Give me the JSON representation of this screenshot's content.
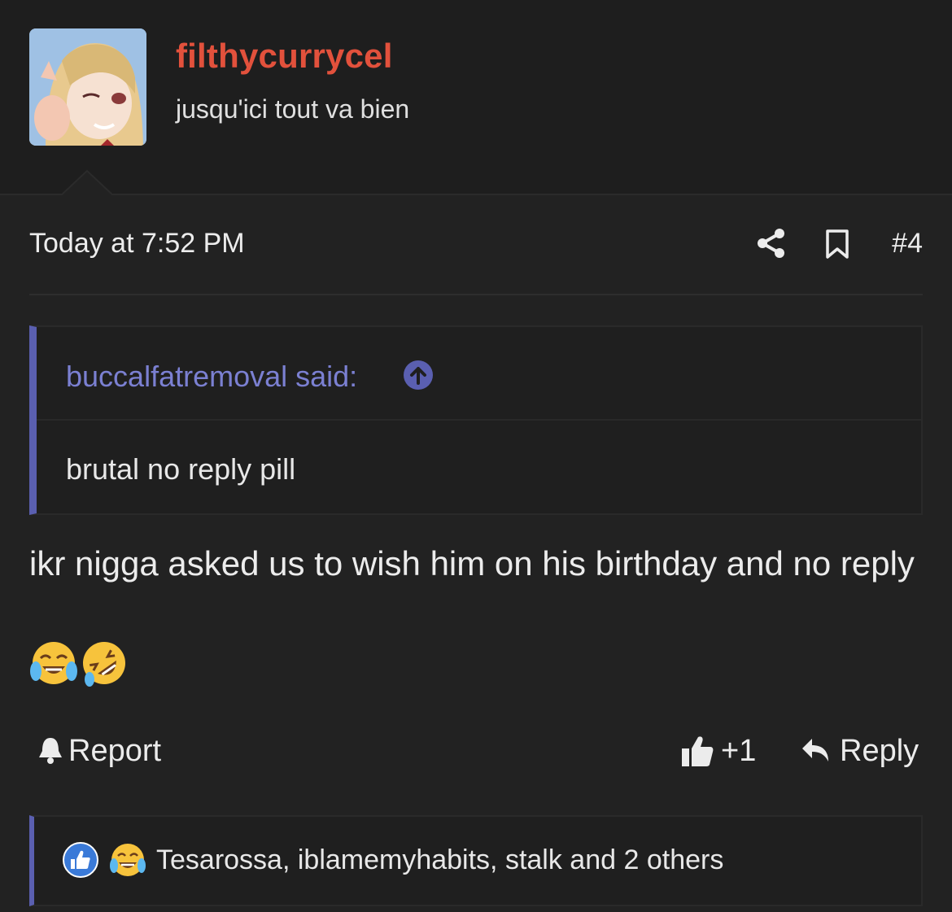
{
  "user": {
    "name": "filthycurrycel",
    "title": "jusqu'ici tout va bien"
  },
  "post": {
    "timestamp": "Today at 7:52 PM",
    "number": "#4",
    "quote": {
      "author_line": "buccalfatremoval said:",
      "text": "brutal no reply pill"
    },
    "message": "ikr nigga asked us to wish him on his birthday and no reply",
    "emojis": [
      "face-with-tears-of-joy",
      "rolling-on-floor-laughing"
    ]
  },
  "actions": {
    "report_label": "Report",
    "like_count": "+1",
    "reply_label": "Reply"
  },
  "reactions": {
    "icons": [
      "like-reaction",
      "laugh-reaction"
    ],
    "text": "Tesarossa, iblamemyhabits, stalk and 2 others"
  },
  "colors": {
    "background": "#1c1c1c",
    "username": "#e2513c",
    "accent": "#5a5fb0",
    "quote_link": "#7b80d2"
  }
}
